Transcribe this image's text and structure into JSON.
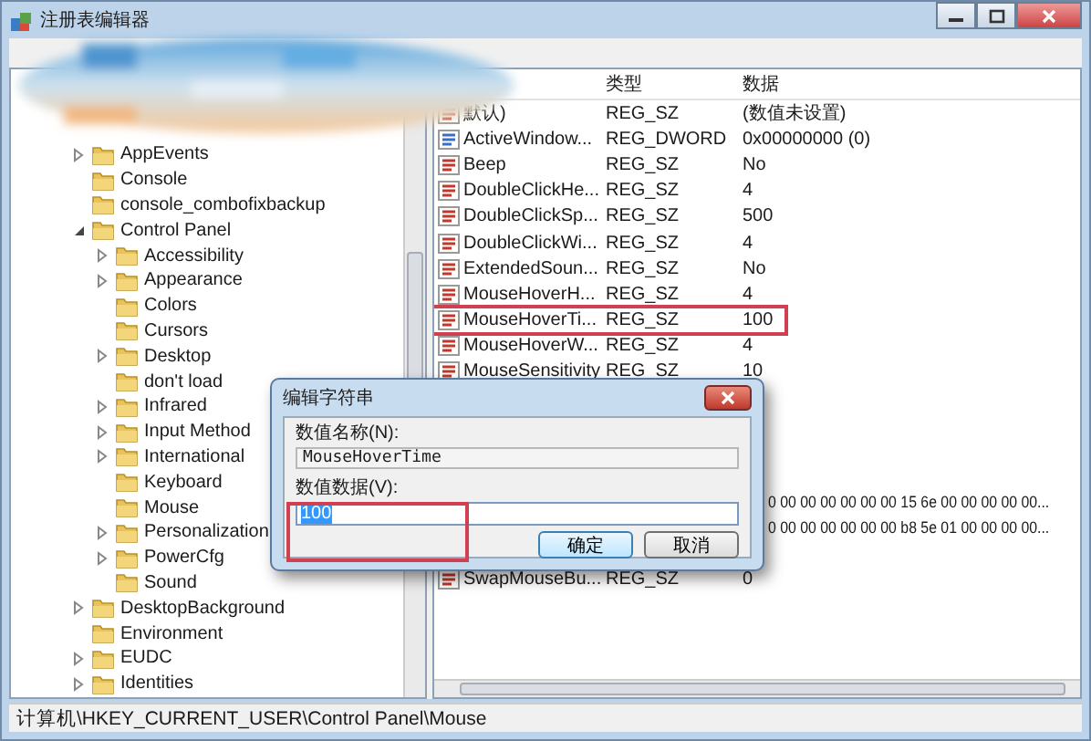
{
  "window": {
    "title": "注册表编辑器"
  },
  "tree": [
    {
      "label": "AppEvents",
      "expandable": true,
      "expanded": false
    },
    {
      "label": "Console",
      "expandable": false
    },
    {
      "label": "console_combofixbackup",
      "expandable": false
    },
    {
      "label": "Control Panel",
      "expandable": true,
      "expanded": true,
      "children": [
        {
          "label": "Accessibility",
          "expandable": true,
          "expanded": false
        },
        {
          "label": "Appearance",
          "expandable": true,
          "expanded": false
        },
        {
          "label": "Colors",
          "expandable": false
        },
        {
          "label": "Cursors",
          "expandable": false
        },
        {
          "label": "Desktop",
          "expandable": true,
          "expanded": false
        },
        {
          "label": "don't load",
          "expandable": false
        },
        {
          "label": "Infrared",
          "expandable": true,
          "expanded": false
        },
        {
          "label": "Input Method",
          "expandable": true,
          "expanded": false
        },
        {
          "label": "International",
          "expandable": true,
          "expanded": false
        },
        {
          "label": "Keyboard",
          "expandable": false
        },
        {
          "label": "Mouse",
          "expandable": false
        },
        {
          "label": "Personalization",
          "expandable": true,
          "expanded": false
        },
        {
          "label": "PowerCfg",
          "expandable": true,
          "expanded": false
        },
        {
          "label": "Sound",
          "expandable": false
        }
      ]
    },
    {
      "label": "DesktopBackground",
      "expandable": true,
      "expanded": false
    },
    {
      "label": "Environment",
      "expandable": false
    },
    {
      "label": "EUDC",
      "expandable": true,
      "expanded": false
    },
    {
      "label": "Identities",
      "expandable": true,
      "expanded": false
    }
  ],
  "list": {
    "columns": [
      "类型",
      "数据"
    ],
    "rows": [
      {
        "kind": "string",
        "name": "默认)",
        "type": "REG_SZ",
        "data": "(数值未设置)",
        "highlighted": false
      },
      {
        "kind": "dword",
        "name": "ActiveWindow...",
        "type": "REG_DWORD",
        "data": "0x00000000 (0)",
        "highlighted": false
      },
      {
        "kind": "string",
        "name": "Beep",
        "type": "REG_SZ",
        "data": "No",
        "highlighted": false
      },
      {
        "kind": "string",
        "name": "DoubleClickHe...",
        "type": "REG_SZ",
        "data": "4",
        "highlighted": false
      },
      {
        "kind": "string",
        "name": "DoubleClickSp...",
        "type": "REG_SZ",
        "data": "500",
        "highlighted": false
      },
      {
        "kind": "string",
        "name": "DoubleClickWi...",
        "type": "REG_SZ",
        "data": "4",
        "highlighted": false
      },
      {
        "kind": "string",
        "name": "ExtendedSoun...",
        "type": "REG_SZ",
        "data": "No",
        "highlighted": false
      },
      {
        "kind": "string",
        "name": "MouseHoverH...",
        "type": "REG_SZ",
        "data": "4",
        "highlighted": false
      },
      {
        "kind": "string",
        "name": "MouseHoverTi...",
        "type": "REG_SZ",
        "data": "100",
        "highlighted": true
      },
      {
        "kind": "string",
        "name": "MouseHoverW...",
        "type": "REG_SZ",
        "data": "4",
        "highlighted": false
      },
      {
        "kind": "string",
        "name": "MouseSensitivity",
        "type": "REG_SZ",
        "data": "10",
        "highlighted": false
      },
      {
        "kind": "data_only",
        "data": "0 00 00 00 00 00 00 15 6e 00 00 00 00 00...",
        "highlighted": false
      },
      {
        "kind": "data_only",
        "data": "0 00 00 00 00 00 00 b8 5e 01 00 00 00 00...",
        "highlighted": false
      },
      {
        "kind": "string",
        "name": "SwapMouseBu...",
        "type": "REG_SZ",
        "data": "0",
        "highlighted": false
      }
    ]
  },
  "status_bar": "计算机\\HKEY_CURRENT_USER\\Control Panel\\Mouse",
  "dialog": {
    "title": "编辑字符串",
    "name_label": "数值名称(N):",
    "name_value": "MouseHoverTime",
    "data_label": "数值数据(V):",
    "data_value": "100",
    "data_highlighted": true,
    "buttons": [
      {
        "label": "确定",
        "default": true
      },
      {
        "label": "取消",
        "default": false
      }
    ]
  }
}
